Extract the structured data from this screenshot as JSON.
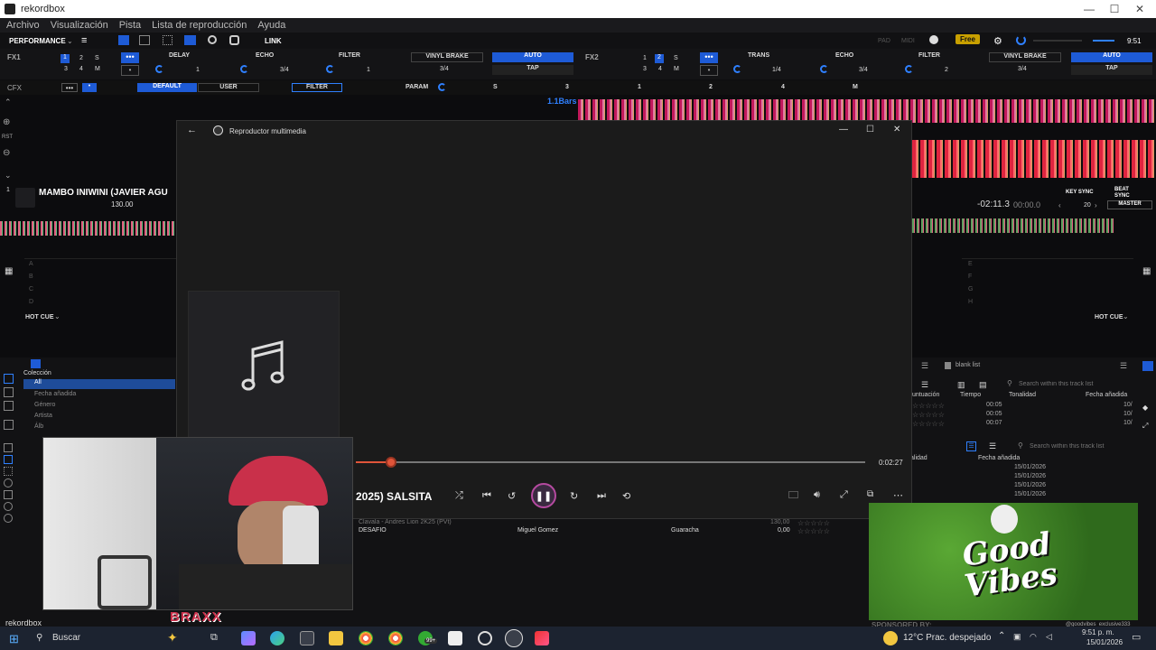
{
  "window": {
    "title": "rekordbox"
  },
  "menu": [
    "Archivo",
    "Visualización",
    "Pista",
    "Lista de reproducción",
    "Ayuda"
  ],
  "toolbar": {
    "mode": "PERFORMANCE",
    "link": "LINK",
    "pad": "PAD",
    "midi": "MIDI",
    "free": "Free",
    "time": "9:51"
  },
  "fx1": {
    "label": "FX1",
    "slots": [
      "DELAY",
      "ECHO",
      "FILTER"
    ],
    "vinyl": "VINYL BRAKE",
    "auto": "AUTO",
    "tap": "TAP",
    "beat_values": [
      "1",
      "3/4",
      "1"
    ],
    "vinyl_beat": "3/4",
    "nums": [
      "1",
      "2",
      "S",
      "3",
      "4",
      "M"
    ]
  },
  "fx2": {
    "label": "FX2",
    "slots": [
      "TRANS",
      "ECHO",
      "FILTER"
    ],
    "vinyl": "VINYL BRAKE",
    "auto": "AUTO",
    "tap": "TAP",
    "beat_values": [
      "1/4",
      "3/4",
      "2"
    ],
    "vinyl_beat": "3/4",
    "nums": [
      "1",
      "2",
      "S",
      "3",
      "4",
      "M"
    ]
  },
  "cfx": {
    "label": "CFX",
    "default": "DEFAULT",
    "user": "USER",
    "filter": "FILTER",
    "param": "PARAM",
    "s": "S",
    "vals": [
      "3",
      "1",
      "2",
      "4"
    ],
    "m": "M"
  },
  "deck1": {
    "title": "MAMBO INIWINI (JAVIER AGU",
    "bpm": "130.00",
    "bars": "1.1Bars",
    "rst": "RST",
    "deck_num": "1",
    "hot_cue": "HOT CUE",
    "cues": [
      "A",
      "B",
      "C",
      "D"
    ]
  },
  "deck2": {
    "time_remaining": "-02:11.3",
    "time_elapsed": "00:00.0",
    "key_sync": "KEY SYNC",
    "beat_sync": "BEAT SYNC",
    "master": "MASTER",
    "beat": "20",
    "hot_cue": "HOT CUE",
    "cues": [
      "E",
      "F",
      "G",
      "H"
    ]
  },
  "browser": {
    "tree_items": [
      "Colección",
      "All",
      "Fecha añadida",
      "Género",
      "Artista",
      "Álb"
    ],
    "blank_list": "blank list",
    "search_placeholder": "Search within this track list",
    "search_placeholder2": "Search within this track list",
    "columns_top": [
      "untuación",
      "Tiempo",
      "Tonalidad",
      "Fecha añadida"
    ],
    "rows_top": [
      {
        "time": "00:05",
        "date": "10/"
      },
      {
        "time": "00:05",
        "date": "10/"
      },
      {
        "time": "00:07",
        "date": "10/"
      }
    ],
    "columns_bottom": [
      "alidad",
      "Fecha añadida"
    ],
    "dates_bottom": [
      "15/01/2026",
      "15/01/2026",
      "15/01/2026",
      "15/01/2026"
    ],
    "tracks": [
      {
        "title": "Clavala - Andres Lion 2K25 (PVt)",
        "artist": "",
        "genre": "",
        "bpm": "130,00"
      },
      {
        "title": "DESAFIO",
        "artist": "Miguel Gomez",
        "genre": "Guaracha",
        "bpm": "0,00"
      }
    ]
  },
  "player": {
    "title": "Reproductor multimedia",
    "track_title": "2025) SALSITA",
    "duration": "0:02:27",
    "progress": 0.07
  },
  "overlay": {
    "rekordbox_label": "rekordbox",
    "braxx": "BRAXX",
    "promo_text": "Good Vibes",
    "sponsored": "SPONSORED BY:",
    "handle": "@goodvibes_exclusive333"
  },
  "taskbar": {
    "search": "Buscar",
    "weather": "12°C  Prac. despejado",
    "clock_time": "9:51 p. m.",
    "clock_date": "15/01/2026",
    "badge": "99+"
  }
}
